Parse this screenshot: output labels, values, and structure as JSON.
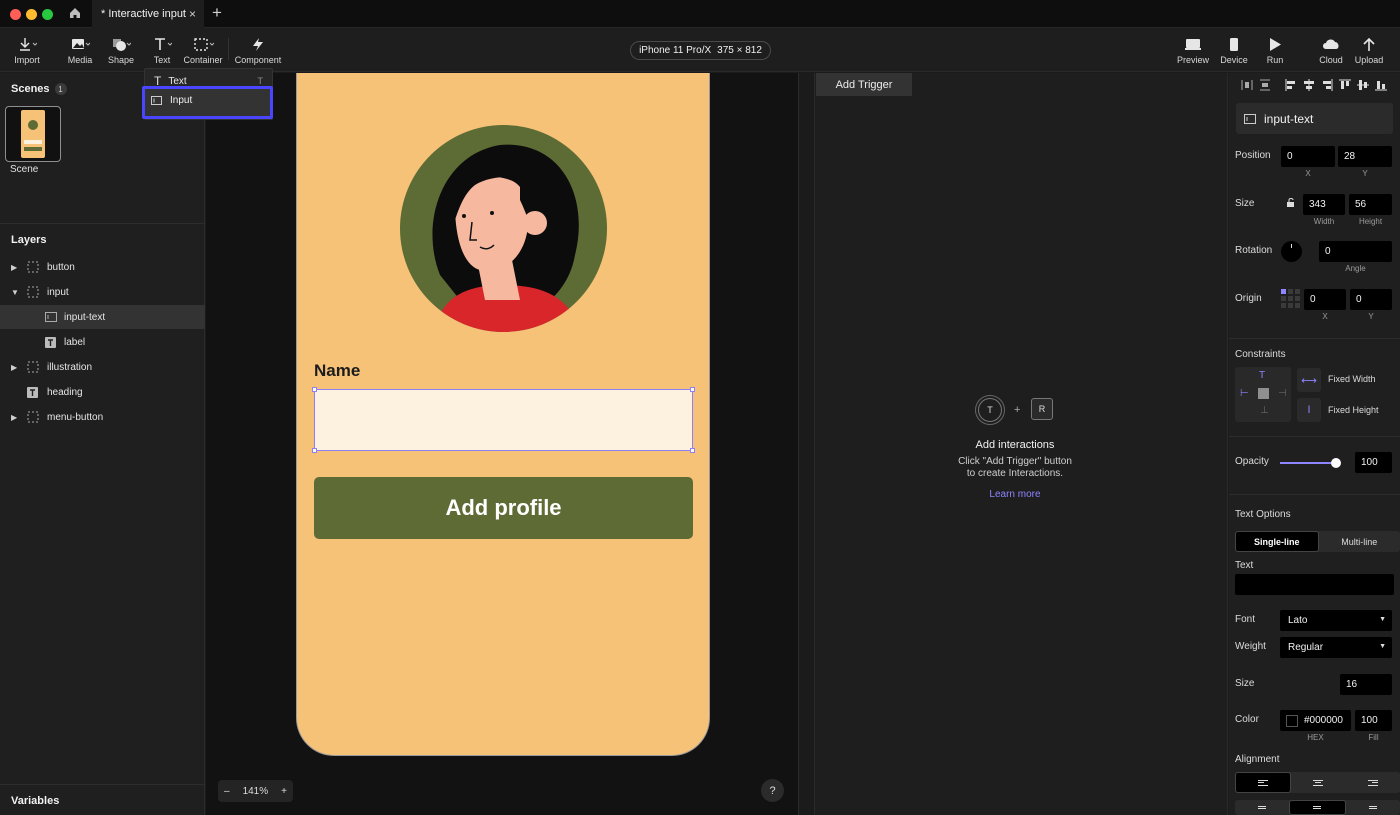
{
  "window": {
    "tab_title": "* Interactive input",
    "tab_close": "×",
    "new_tab": "+"
  },
  "toolbar": {
    "tools": [
      {
        "label": "Import",
        "icon": "import-icon"
      },
      {
        "label": "Media",
        "icon": "media-icon"
      },
      {
        "label": "Shape",
        "icon": "shape-icon"
      },
      {
        "label": "Text",
        "icon": "text-icon"
      },
      {
        "label": "Container",
        "icon": "container-icon"
      },
      {
        "label": "Component",
        "icon": "component-icon"
      }
    ],
    "device": "iPhone 11 Pro/X",
    "device_size": "375 × 812",
    "right_tools": [
      {
        "label": "Preview",
        "icon": "preview-icon"
      },
      {
        "label": "Device",
        "icon": "device-icon"
      },
      {
        "label": "Run",
        "icon": "run-icon"
      },
      {
        "label": "Cloud",
        "icon": "cloud-icon"
      },
      {
        "label": "Upload",
        "icon": "upload-icon"
      }
    ]
  },
  "dropdown": {
    "items": [
      {
        "label": "Text",
        "shortcut": "T"
      },
      {
        "label": "Input",
        "shortcut": ""
      }
    ],
    "highlighted": "Input"
  },
  "left_panel": {
    "scenes_title": "Scenes",
    "scenes_count": "1",
    "scene_label": "Scene",
    "layers_title": "Layers",
    "layers": [
      {
        "name": "button",
        "type": "container",
        "caret": "▶"
      },
      {
        "name": "input",
        "type": "container",
        "caret": "▼"
      },
      {
        "name": "input-text",
        "type": "input",
        "caret": ""
      },
      {
        "name": "label",
        "type": "text",
        "caret": ""
      },
      {
        "name": "illustration",
        "type": "container",
        "caret": "▶"
      },
      {
        "name": "heading",
        "type": "text",
        "caret": ""
      },
      {
        "name": "menu-button",
        "type": "container",
        "caret": "▶"
      }
    ],
    "selected_layer": "input-text",
    "variables_title": "Variables"
  },
  "canvas": {
    "name_label": "Name",
    "input_value": "",
    "button_label": "Add profile",
    "zoom": "141%",
    "zoom_minus": "–",
    "zoom_plus": "+",
    "help": "?",
    "colors": {
      "background": "#f6c278",
      "button": "#5f6b35",
      "input": "#fdf1e0",
      "avatar_bg": "#5d6b35"
    }
  },
  "interactions": {
    "add_trigger": "Add Trigger",
    "trigger_badge": "T",
    "plus": "+",
    "response_badge": "R",
    "heading": "Add interactions",
    "description_line1": "Click \"Add Trigger\" button",
    "description_line2": "to create Interactions.",
    "link": "Learn more"
  },
  "properties": {
    "layer_name": "input-text",
    "position": {
      "label": "Position",
      "x": "0",
      "y": "28",
      "x_sub": "X",
      "y_sub": "Y"
    },
    "size": {
      "label": "Size",
      "width": "343",
      "height": "56",
      "w_sub": "Width",
      "h_sub": "Height"
    },
    "rotation": {
      "label": "Rotation",
      "angle": "0",
      "sub": "Angle"
    },
    "origin": {
      "label": "Origin",
      "x": "0",
      "y": "0",
      "x_sub": "X",
      "y_sub": "Y"
    },
    "constraints": {
      "label": "Constraints",
      "fixed_width": "Fixed Width",
      "fixed_height": "Fixed Height"
    },
    "opacity": {
      "label": "Opacity",
      "value": "100",
      "fraction": 1.0
    },
    "text_options": {
      "label": "Text Options",
      "single_line": "Single-line",
      "multi_line": "Multi-line",
      "text_label": "Text",
      "text_value": "",
      "font_label": "Font",
      "font": "Lato",
      "weight_label": "Weight",
      "weight": "Regular",
      "size_label": "Size",
      "size": "16",
      "color_label": "Color",
      "color_hex": "#000000",
      "color_fill": "100",
      "hex_sub": "HEX",
      "fill_sub": "Fill",
      "alignment_label": "Alignment"
    },
    "accent": "#8d84ff"
  }
}
